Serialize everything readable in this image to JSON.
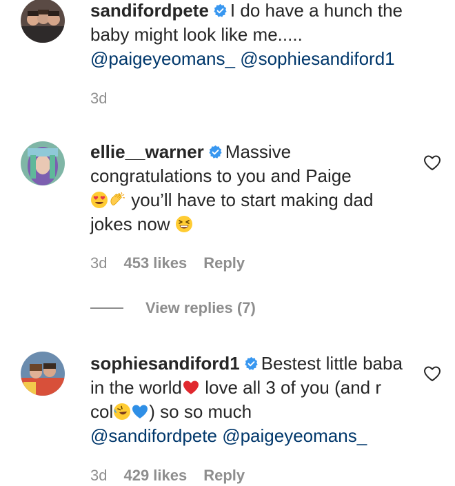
{
  "comments": [
    {
      "username": "sandifordpete",
      "text_1": "I do have a hunch the baby might look like me.....",
      "mention_1": "@paigeyeomans_",
      "mention_2": "@sophiesandiford1",
      "time": "3d"
    },
    {
      "username": "ellie__warner",
      "text_1": "Massive congratulations to you and Paige",
      "text_2": "you’ll have to start making dad jokes now",
      "time": "3d",
      "likes": "453 likes",
      "reply": "Reply",
      "view_replies": "View replies (7)"
    },
    {
      "username": "sophiesandiford1",
      "text_1": "Bestest little baba in the world",
      "text_2": "love all 3 of you (and r col",
      "text_3": ") so so much",
      "mention_1": "@sandifordpete",
      "mention_2": "@paigeyeomans_",
      "time": "3d",
      "likes": "429 likes",
      "reply": "Reply"
    }
  ],
  "icons": {
    "verified": "verified-badge-icon",
    "like": "heart-outline-icon"
  },
  "colors": {
    "text": "#262626",
    "mention": "#00376b",
    "secondary": "#8e8e8e",
    "verified": "#3897f0"
  }
}
